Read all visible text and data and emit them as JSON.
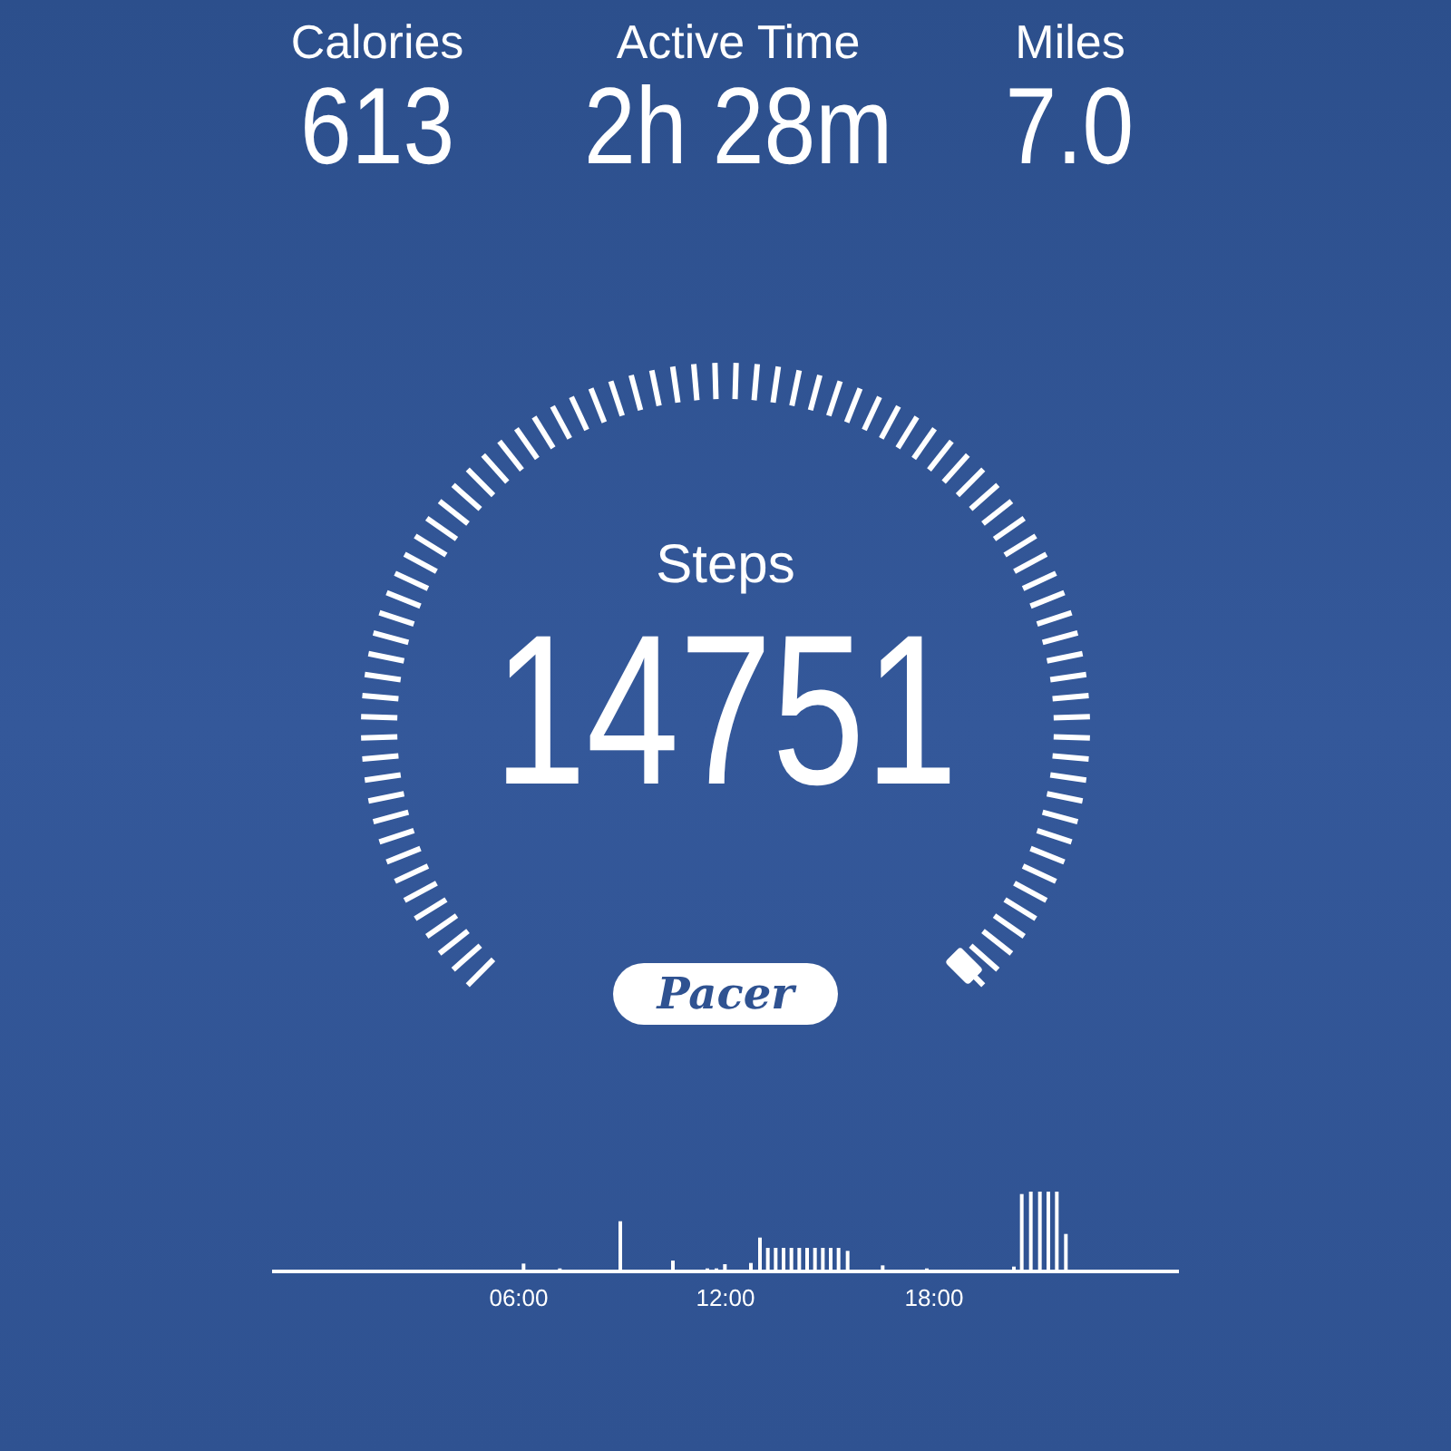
{
  "stats": [
    {
      "label": "Calories",
      "value": "613"
    },
    {
      "label": "Active Time",
      "value": "2h 28m"
    },
    {
      "label": "Miles",
      "value": "7.0"
    }
  ],
  "gauge": {
    "label": "Steps",
    "value": "14751"
  },
  "logo": {
    "text": "Pacer"
  },
  "activity_chart": {
    "time_labels": [
      "06:00",
      "12:00",
      "18:00"
    ]
  }
}
